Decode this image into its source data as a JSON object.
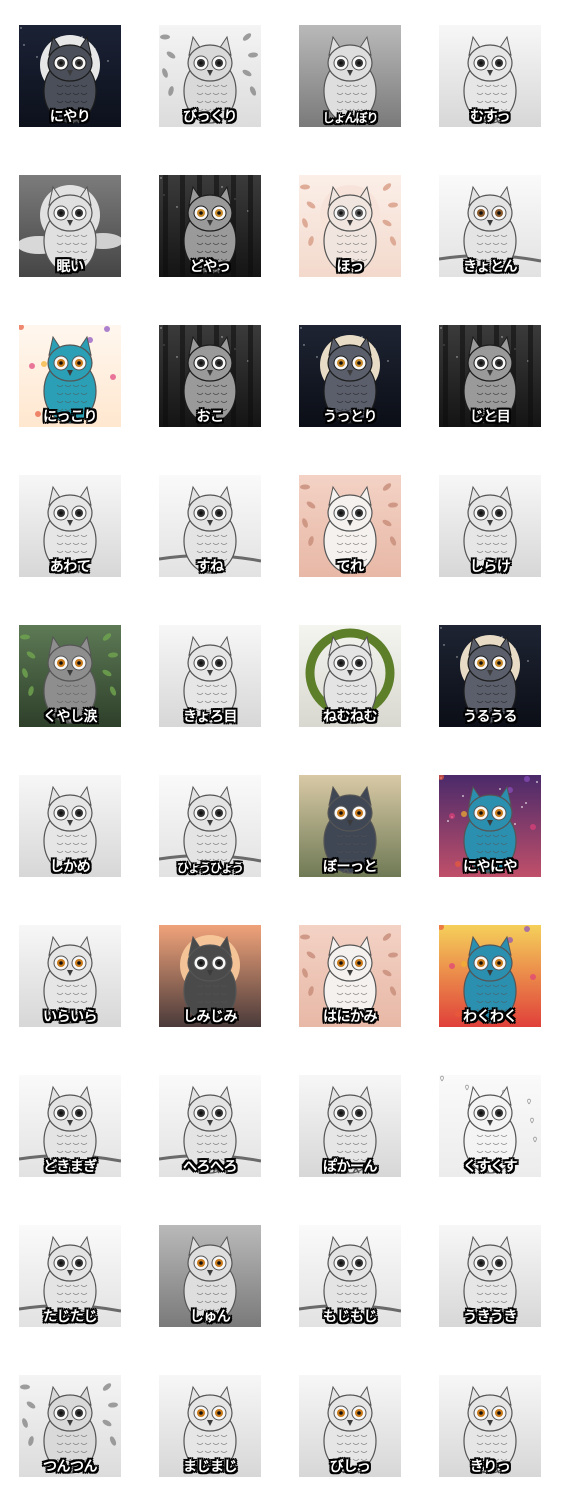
{
  "stickers": [
    {
      "label": "にやり",
      "theme": "dark-moon",
      "eyes": "#3a3a3a"
    },
    {
      "label": "びっくり",
      "theme": "leaf-gray",
      "eyes": "#333333"
    },
    {
      "label": "しょんぼり",
      "theme": "gray",
      "eyes": "#333333"
    },
    {
      "label": "むすっ",
      "theme": "light",
      "eyes": "#333333"
    },
    {
      "label": "眠い",
      "theme": "cloud-moon",
      "eyes": "#333333"
    },
    {
      "label": "どやっ",
      "theme": "dark-forest",
      "eyes": "#c98a2a"
    },
    {
      "label": "ほっ",
      "theme": "peach-moon",
      "eyes": "#555555"
    },
    {
      "label": "きょとん",
      "theme": "branch-light",
      "eyes": "#8a5a2a"
    },
    {
      "label": "にっこり",
      "theme": "colorful",
      "eyes": "#c97a1a"
    },
    {
      "label": "おこ",
      "theme": "dark-forest",
      "eyes": "#333333"
    },
    {
      "label": "うっとり",
      "theme": "night-moon",
      "eyes": "#c98a2a"
    },
    {
      "label": "じと目",
      "theme": "dark-forest",
      "eyes": "#333333"
    },
    {
      "label": "あわて",
      "theme": "light",
      "eyes": "#333333"
    },
    {
      "label": "すね",
      "theme": "branch-light",
      "eyes": "#333333"
    },
    {
      "label": "てれ",
      "theme": "pink",
      "eyes": "#333333"
    },
    {
      "label": "しらけ",
      "theme": "light",
      "eyes": "#333333"
    },
    {
      "label": "くやし涙",
      "theme": "green-forest",
      "eyes": "#c97a1a"
    },
    {
      "label": "きょろ目",
      "theme": "light",
      "eyes": "#333333"
    },
    {
      "label": "ねむねむ",
      "theme": "moss-wreath",
      "eyes": "#333333"
    },
    {
      "label": "うるうる",
      "theme": "night-moon",
      "eyes": "#c98a2a"
    },
    {
      "label": "しかめ",
      "theme": "light",
      "eyes": "#333333"
    },
    {
      "label": "ひょうひょう",
      "theme": "branch-light",
      "eyes": "#333333"
    },
    {
      "label": "ぼーっと",
      "theme": "sunlit-forest",
      "eyes": "#c97a1a"
    },
    {
      "label": "にやにや",
      "theme": "cosmic",
      "eyes": "#c97a1a"
    },
    {
      "label": "いらいら",
      "theme": "light",
      "eyes": "#c97a1a"
    },
    {
      "label": "しみじみ",
      "theme": "sunset",
      "eyes": "#333333"
    },
    {
      "label": "はにかみ",
      "theme": "pink",
      "eyes": "#c97a1a"
    },
    {
      "label": "わくわく",
      "theme": "burst",
      "eyes": "#c97a1a"
    },
    {
      "label": "どきまぎ",
      "theme": "branch-light",
      "eyes": "#333333"
    },
    {
      "label": "へろへろ",
      "theme": "branch-light",
      "eyes": "#333333"
    },
    {
      "label": "ぽかーん",
      "theme": "light",
      "eyes": "#333333"
    },
    {
      "label": "くすくす",
      "theme": "hearts",
      "eyes": "#333333"
    },
    {
      "label": "たじたじ",
      "theme": "branch-light",
      "eyes": "#333333"
    },
    {
      "label": "しゅん",
      "theme": "gray",
      "eyes": "#c97a1a"
    },
    {
      "label": "もじもじ",
      "theme": "branch-light",
      "eyes": "#333333"
    },
    {
      "label": "うきうき",
      "theme": "light",
      "eyes": "#333333"
    },
    {
      "label": "つんつん",
      "theme": "leaf-gray",
      "eyes": "#333333"
    },
    {
      "label": "まじまじ",
      "theme": "light",
      "eyes": "#c97a1a"
    },
    {
      "label": "びしっ",
      "theme": "light",
      "eyes": "#c97a1a"
    },
    {
      "label": "きりっ",
      "theme": "light",
      "eyes": "#c97a1a"
    }
  ],
  "colors": {
    "label_fill": "#ffffff",
    "label_outline": "#000000",
    "background": "#ffffff"
  }
}
